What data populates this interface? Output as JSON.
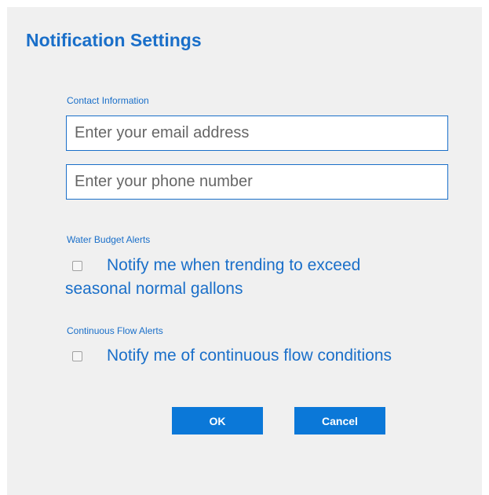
{
  "dialog": {
    "title": "Notification Settings"
  },
  "contact": {
    "section_label": "Contact Information",
    "email_placeholder": "Enter your email address",
    "email_value": "",
    "phone_placeholder": "Enter your phone number",
    "phone_value": ""
  },
  "water_budget": {
    "section_label": "Water Budget Alerts",
    "checkbox_label_line1": "Notify me when trending to exceed",
    "checkbox_label_line2": "seasonal normal gallons",
    "checked": false
  },
  "continuous_flow": {
    "section_label": "Continuous Flow Alerts",
    "checkbox_label": "Notify me of continuous flow conditions",
    "checked": false
  },
  "buttons": {
    "ok_label": "OK",
    "cancel_label": "Cancel"
  },
  "colors": {
    "accent": "#1a6fc9",
    "button_bg": "#0b78d8",
    "panel_bg": "#f0f0f0"
  }
}
